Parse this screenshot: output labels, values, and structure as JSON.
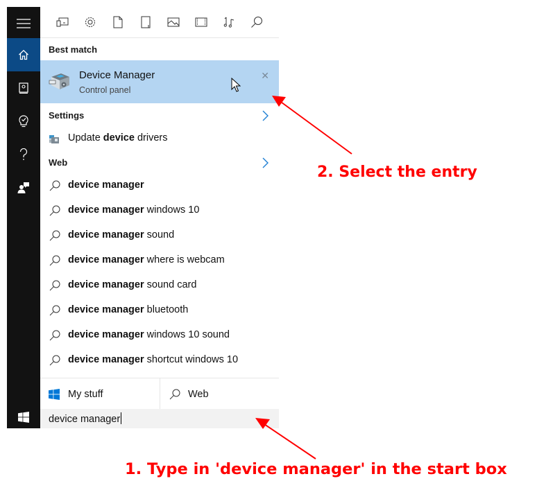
{
  "sidebar": {
    "items": [
      {
        "name": "hamburger-menu",
        "icon": "hamburger-icon"
      },
      {
        "name": "home",
        "icon": "home-icon",
        "active": true
      },
      {
        "name": "notebook",
        "icon": "notebook-icon"
      },
      {
        "name": "reminders",
        "icon": "lightbulb-icon"
      },
      {
        "name": "help",
        "icon": "question-icon"
      },
      {
        "name": "feedback",
        "icon": "feedback-icon"
      }
    ],
    "start_icon": "windows-logo-icon"
  },
  "toolbar": {
    "filters": [
      "apps-icon",
      "settings-icon",
      "documents-icon",
      "folders-icon",
      "photos-icon",
      "videos-icon",
      "music-icon",
      "web-icon"
    ]
  },
  "best_match": {
    "label": "Best match",
    "title": "Device Manager",
    "subtitle": "Control panel",
    "close_glyph": "✕"
  },
  "settings": {
    "label": "Settings",
    "items": [
      {
        "pre": "Update ",
        "bold": "device",
        "post": " drivers"
      }
    ]
  },
  "web": {
    "label": "Web",
    "results": [
      {
        "bold": "device manager",
        "rest": ""
      },
      {
        "bold": "device manager",
        "rest": " windows 10"
      },
      {
        "bold": "device manager",
        "rest": " sound"
      },
      {
        "bold": "device manager",
        "rest": " where is webcam"
      },
      {
        "bold": "device manager",
        "rest": " sound card"
      },
      {
        "bold": "device manager",
        "rest": " bluetooth"
      },
      {
        "bold": "device manager",
        "rest": " windows 10 sound"
      },
      {
        "bold": "device manager",
        "rest": " shortcut windows 10"
      }
    ]
  },
  "scope": {
    "my_stuff": "My stuff",
    "web": "Web"
  },
  "search": {
    "value": "device manager"
  },
  "annotations": {
    "step1": "1. Type in 'device manager' in the start box",
    "step2": "2. Select the entry",
    "color": "#ff0000"
  },
  "colors": {
    "sidebar": "#121212",
    "sidebar_active": "#0c4a86",
    "selection": "#b4d5f2",
    "search_bg": "#f2f2f2",
    "accent": "#0078d7"
  }
}
